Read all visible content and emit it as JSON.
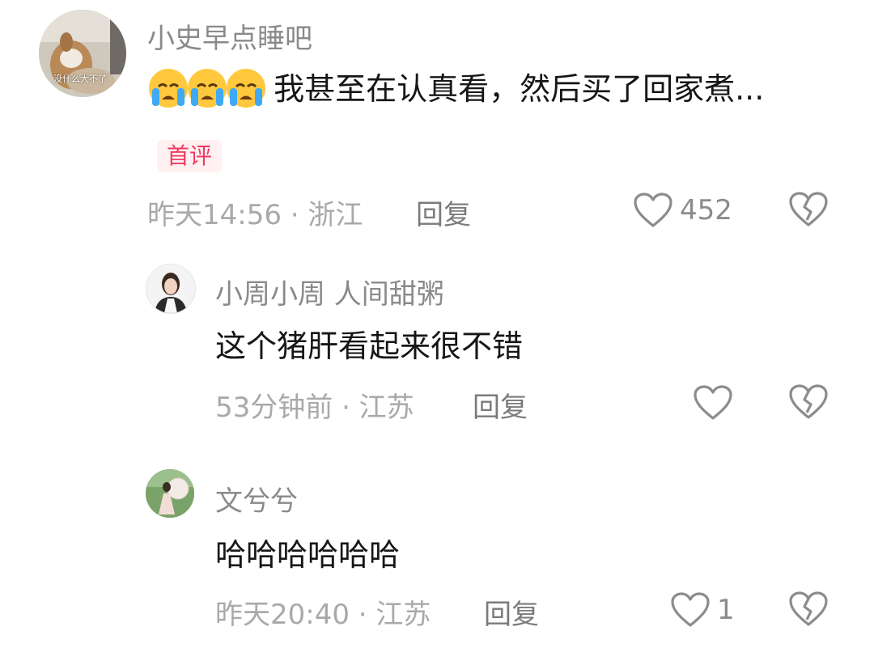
{
  "comments": [
    {
      "author": "小史早点睡吧",
      "avatar_caption": "没什么大不了",
      "emoji": [
        "loudly-crying-face",
        "loudly-crying-face",
        "loudly-crying-face"
      ],
      "text": "我甚至在认真看，然后买了回家煮...",
      "badge": "首评",
      "meta": "昨天14:56 · 浙江",
      "reply_label": "回复",
      "likes": "452"
    },
    {
      "author": "小周小周 人间甜粥",
      "text": "这个猪肝看起来很不错",
      "meta": "53分钟前 · 江苏",
      "reply_label": "回复",
      "likes": ""
    },
    {
      "author": "文兮兮",
      "text": "哈哈哈哈哈哈",
      "meta": "昨天20:40 · 江苏",
      "reply_label": "回复",
      "likes": "1"
    }
  ],
  "colors": {
    "name": "#8a8a8a",
    "meta": "#a9a9a9",
    "badge_bg": "#fff0f2",
    "badge_text": "#ef3b5f",
    "icon": "#8c8c8c"
  }
}
